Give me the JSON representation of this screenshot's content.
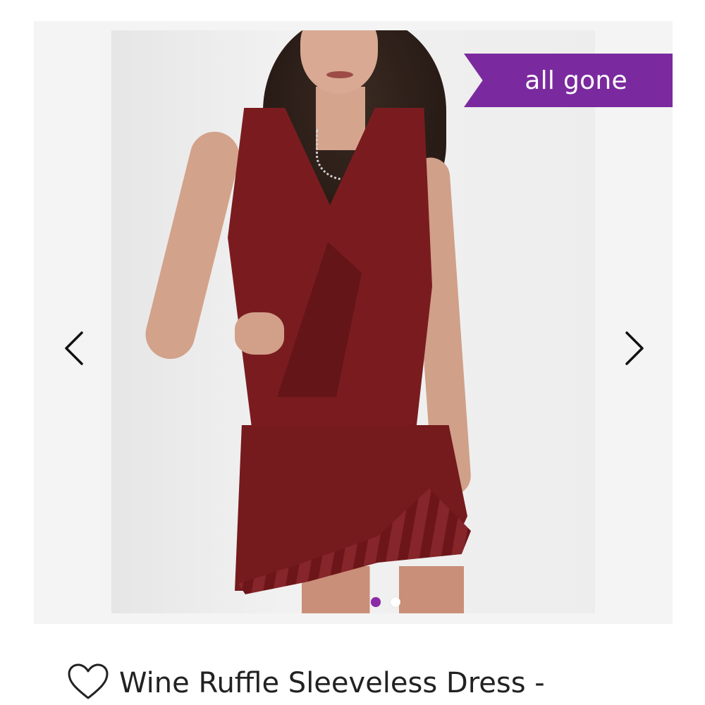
{
  "product": {
    "title": "Wine Ruffle Sleeveless Dress -",
    "status_badge": "all gone",
    "image": {
      "description_icon": "product-photo"
    }
  },
  "gallery": {
    "prev_icon": "chevron-left-icon",
    "next_icon": "chevron-right-icon",
    "dots_total": 2,
    "active_dot": 1
  },
  "colors": {
    "badge": "#7a2a9e",
    "active_dot": "#8a2aa6",
    "dress": "#7a1c1f"
  },
  "icons": {
    "favorite": "heart-icon"
  }
}
